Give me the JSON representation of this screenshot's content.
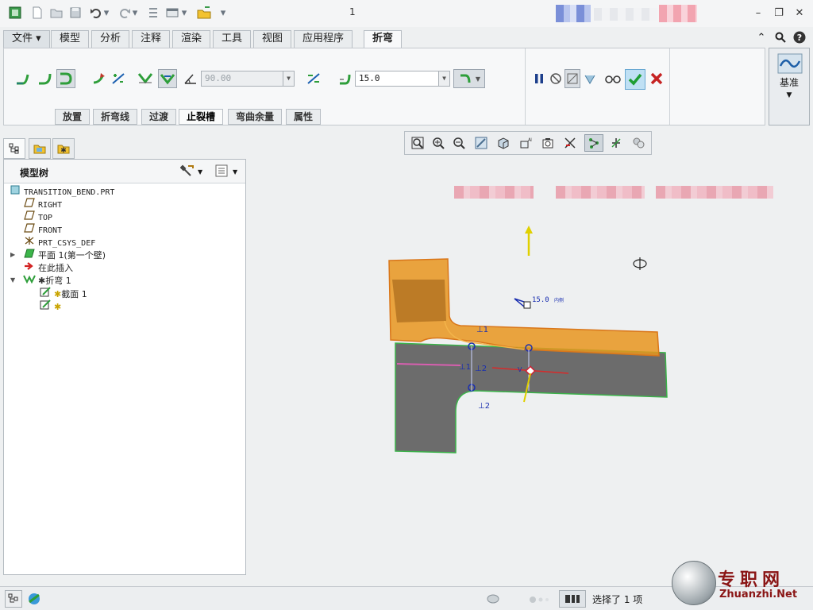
{
  "window": {
    "title": "1"
  },
  "menu": {
    "tabs": [
      {
        "id": "file",
        "label": "文件"
      },
      {
        "id": "model",
        "label": "模型"
      },
      {
        "id": "analysis",
        "label": "分析"
      },
      {
        "id": "annotate",
        "label": "注释"
      },
      {
        "id": "render",
        "label": "渲染"
      },
      {
        "id": "tools",
        "label": "工具"
      },
      {
        "id": "view",
        "label": "视图"
      },
      {
        "id": "apps",
        "label": "应用程序"
      },
      {
        "id": "bend",
        "label": "折弯"
      }
    ],
    "active": "bend"
  },
  "ribbon": {
    "angle_value": "90.00",
    "radius_value": "15.0",
    "datum_label": "基准",
    "sub_tabs": [
      "放置",
      "折弯线",
      "过渡",
      "止裂槽",
      "弯曲余量",
      "属性"
    ],
    "active_sub_tab": "止裂槽"
  },
  "model_tree": {
    "title": "模型树",
    "items": [
      {
        "label": "TRANSITION_BEND.PRT",
        "icon": "part-icon",
        "level": 0
      },
      {
        "label": "RIGHT",
        "icon": "datum-plane-icon",
        "level": 1
      },
      {
        "label": "TOP",
        "icon": "datum-plane-icon",
        "level": 1
      },
      {
        "label": "FRONT",
        "icon": "datum-plane-icon",
        "level": 1
      },
      {
        "label": "PRT_CSYS_DEF",
        "icon": "csys-icon",
        "level": 1
      },
      {
        "label": "平面 1(第一个壁)",
        "icon": "flat-wall-icon",
        "level": 1,
        "expander": "▶"
      },
      {
        "label": "在此插入",
        "icon": "insert-here-icon",
        "level": 1
      },
      {
        "label": "折弯 1",
        "icon": "bend-icon",
        "level": 1,
        "expander": "▼"
      },
      {
        "label": "截面 1",
        "icon": "sketch-icon",
        "level": 2
      },
      {
        "label": "",
        "icon": "sketch-icon",
        "level": 2
      }
    ]
  },
  "graphics": {
    "dim_radius": "15.0",
    "dim_radius_suffix": "内侧",
    "callout_1": "⊥1",
    "callout_2": "⊥2",
    "callout_3": "⊥1",
    "callout_4": "⊥2",
    "accent_orange": "#e8951e",
    "part_gray": "#6c6c6c",
    "edge_green": "#3bb34a"
  },
  "status": {
    "selection": "选择了 1 项"
  },
  "watermark": {
    "cn": "专职网",
    "en": "Zhuanzhi.Net"
  }
}
